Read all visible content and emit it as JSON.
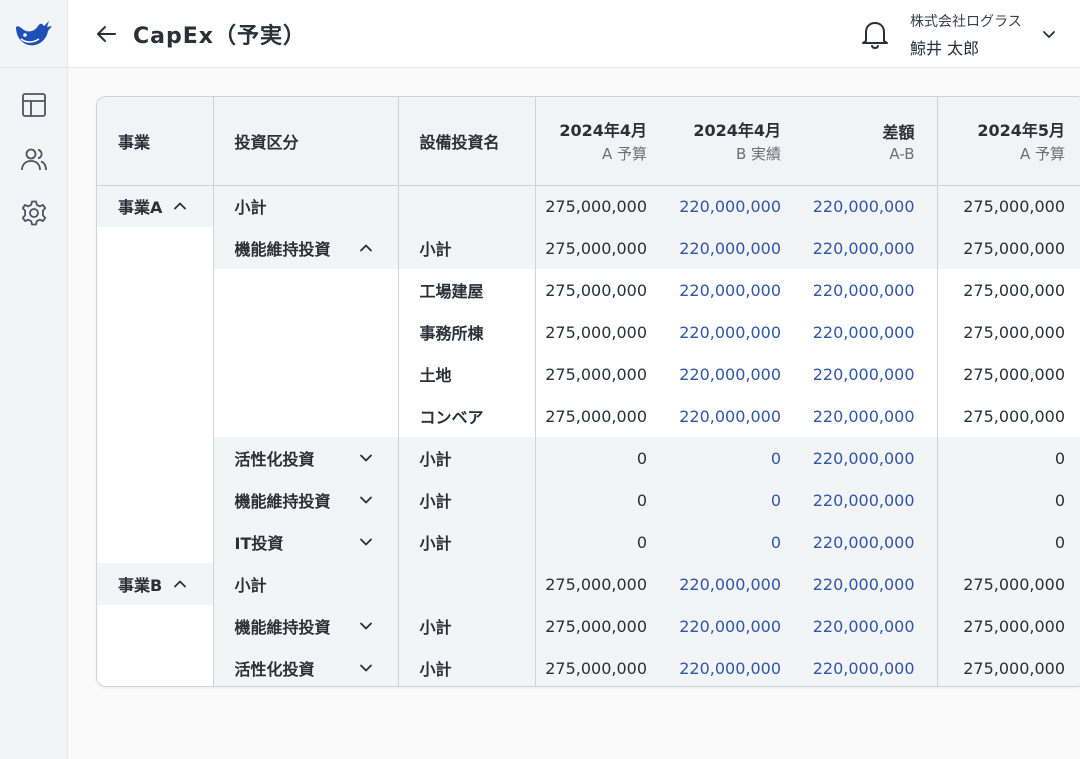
{
  "header": {
    "title": "CapEx（予実）",
    "company": "株式会社ログラス",
    "user": "鯨井 太郎"
  },
  "sidebar": {
    "items": [
      {
        "icon": "layout-icon"
      },
      {
        "icon": "users-icon"
      },
      {
        "icon": "gear-icon"
      }
    ]
  },
  "table": {
    "columns": {
      "business": "事業",
      "category": "投資区分",
      "equipment": "設備投資名",
      "c1_top": "2024年4月",
      "c1_sub": "A 予算",
      "c2_top": "2024年4月",
      "c2_sub": "B 実績",
      "c3_top": "差額",
      "c3_sub": "A-B",
      "c4_top": "2024年5月",
      "c4_sub": "A 予算"
    },
    "rows": [
      {
        "business": "事業A",
        "category": "小計",
        "equipment": "",
        "v": [
          "275,000,000",
          "220,000,000",
          "220,000,000",
          "275,000,000"
        ]
      },
      {
        "business": "",
        "category": "機能維持投資",
        "equipment": "小計",
        "v": [
          "275,000,000",
          "220,000,000",
          "220,000,000",
          "275,000,000"
        ]
      },
      {
        "business": "",
        "category": "",
        "equipment": "工場建屋",
        "v": [
          "275,000,000",
          "220,000,000",
          "220,000,000",
          "275,000,000"
        ]
      },
      {
        "business": "",
        "category": "",
        "equipment": "事務所棟",
        "v": [
          "275,000,000",
          "220,000,000",
          "220,000,000",
          "275,000,000"
        ]
      },
      {
        "business": "",
        "category": "",
        "equipment": "土地",
        "v": [
          "275,000,000",
          "220,000,000",
          "220,000,000",
          "275,000,000"
        ]
      },
      {
        "business": "",
        "category": "",
        "equipment": "コンベア",
        "v": [
          "275,000,000",
          "220,000,000",
          "220,000,000",
          "275,000,000"
        ]
      },
      {
        "business": "",
        "category": "活性化投資",
        "equipment": "小計",
        "v": [
          "0",
          "0",
          "220,000,000",
          "0"
        ]
      },
      {
        "business": "",
        "category": "機能維持投資",
        "equipment": "小計",
        "v": [
          "0",
          "0",
          "220,000,000",
          "0"
        ]
      },
      {
        "business": "",
        "category": "IT投資",
        "equipment": "小計",
        "v": [
          "0",
          "0",
          "220,000,000",
          "0"
        ]
      },
      {
        "business": "事業B",
        "category": "小計",
        "equipment": "",
        "v": [
          "275,000,000",
          "220,000,000",
          "220,000,000",
          "275,000,000"
        ]
      },
      {
        "business": "",
        "category": "機能維持投資",
        "equipment": "小計",
        "v": [
          "275,000,000",
          "220,000,000",
          "220,000,000",
          "275,000,000"
        ]
      },
      {
        "business": "",
        "category": "活性化投資",
        "equipment": "小計",
        "v": [
          "275,000,000",
          "220,000,000",
          "220,000,000",
          "275,000,000"
        ]
      }
    ]
  },
  "colors": {
    "accent": "#2f56a8",
    "logo": "#1f4fb8"
  }
}
